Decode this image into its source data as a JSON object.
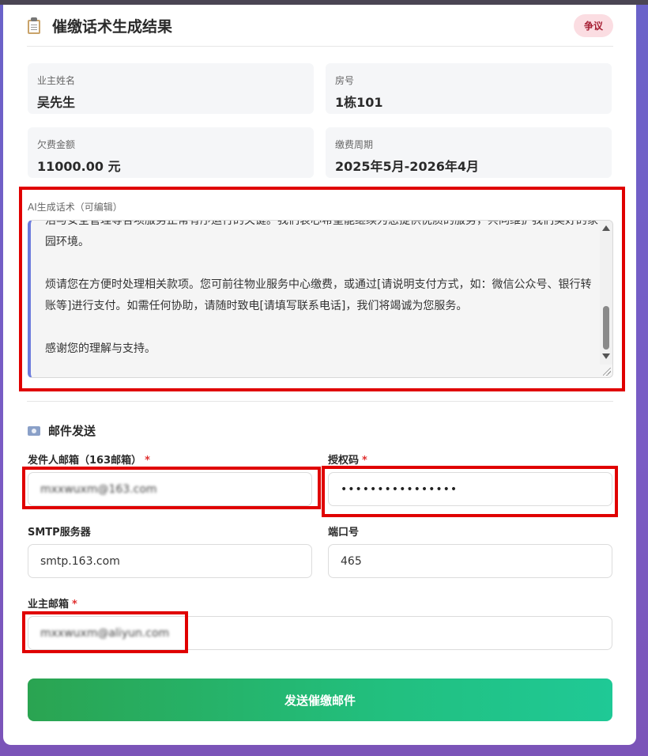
{
  "header": {
    "title": "催缴话术生成结果",
    "badge": "争议"
  },
  "info": [
    {
      "label": "业主姓名",
      "value": "吴先生"
    },
    {
      "label": "房号",
      "value": "1栋101"
    },
    {
      "label": "欠费金额",
      "value": "11000.00 元"
    },
    {
      "label": "缴费周期",
      "value": "2025年5月-2026年4月"
    }
  ],
  "ai": {
    "label": "AI生成话术（可编辑）",
    "paragraphs": [
      "活与安全管理等各项服务正常有序运行的关键。我们衷心希望能继续为您提供优质的服务，共同维护我们美好的家园环境。",
      "烦请您在方便时处理相关款项。您可前往物业服务中心缴费，或通过[请说明支付方式，如：微信公众号、银行转账等]进行支付。如需任何协助，请随时致电[请填写联系电话]，我们将竭诚为您服务。",
      "感谢您的理解与支持。"
    ]
  },
  "email": {
    "section_title": "邮件发送",
    "sender_label": "发件人邮箱（163邮箱）",
    "sender_value": "mxxwuxm@163.com",
    "auth_label": "授权码",
    "auth_value": "••••••••••••••••",
    "smtp_label": "SMTP服务器",
    "smtp_value": "smtp.163.com",
    "port_label": "端口号",
    "port_value": "465",
    "owner_label": "业主邮箱",
    "owner_value": "mxxwuxm@aliyun.com",
    "required_mark": "*"
  },
  "send_button": "发送催缴邮件"
}
